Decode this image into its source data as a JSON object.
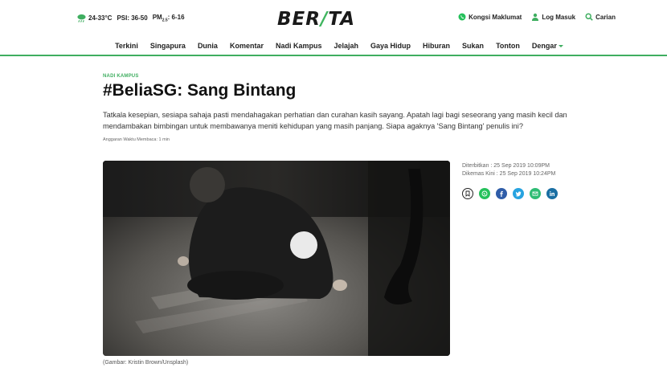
{
  "weather": {
    "temp": "24-33°C",
    "psi": "PSI: 36-50",
    "pm_prefix": "PM",
    "pm_sub": "2.5",
    "pm_value": ": 6-16"
  },
  "brand": {
    "logo_left": "BER",
    "logo_slash": "/",
    "logo_right": "TA"
  },
  "toplinks": {
    "share_news": "Kongsi Maklumat",
    "login": "Log Masuk",
    "search": "Carian"
  },
  "nav": {
    "items": [
      "Terkini",
      "Singapura",
      "Dunia",
      "Komentar",
      "Nadi Kampus",
      "Jelajah",
      "Gaya Hidup",
      "Hiburan",
      "Sukan",
      "Tonton",
      "Dengar"
    ]
  },
  "article": {
    "section": "NADI KAMPUS",
    "title": "#BeliaSG: Sang Bintang",
    "lede": "Tatkala kesepian, sesiapa sahaja pasti mendahagakan perhatian dan curahan kasih sayang. Apatah lagi bagi seseorang yang masih kecil dan mendambakan bimbingan untuk membawanya meniti kehidupan yang masih panjang. Siapa agaknya 'Sang Bintang' penulis ini?",
    "read_time": "Anggaran Waktu Membaca: 1 min",
    "published": "Diterbitkan : 25 Sep 2019 10:09PM",
    "updated": "Dikemas Kini : 25 Sep 2019 10:24PM",
    "caption": "(Gambar: Kristin Brown/Unsplash)"
  },
  "colors": {
    "accent": "#3fae60",
    "whatsapp": "#25c15b",
    "facebook": "#2f5da8",
    "twitter": "#27a3e0",
    "email": "#2ebc74",
    "linkedin": "#1a6fa3"
  }
}
